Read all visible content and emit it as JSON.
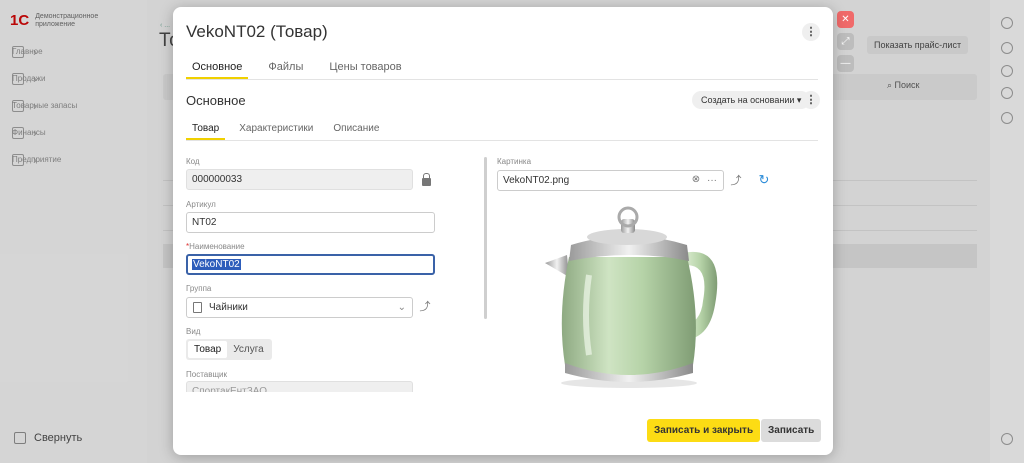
{
  "app": {
    "logo_mark": "1С",
    "logo_text": "Демонстрационное приложение",
    "nav": [
      {
        "label": "Главное"
      },
      {
        "label": "Продажи"
      },
      {
        "label": "Товарные запасы"
      },
      {
        "label": "Финансы"
      },
      {
        "label": "Предприятие"
      }
    ],
    "collapse_label": "Свернуть",
    "bg_title": "То",
    "bg_price_button": "Показать прайс-лист",
    "bg_search": "Поиск"
  },
  "modal": {
    "title": "VekoNT02 (Товар)",
    "tabs": [
      "Основное",
      "Файлы",
      "Цены товаров"
    ],
    "section_title": "Основное",
    "create_based_on": "Создать на основании",
    "subtabs": [
      "Товар",
      "Характеристики",
      "Описание"
    ],
    "fields": {
      "code_label": "Код",
      "code_value": "000000033",
      "sku_label": "Артикул",
      "sku_value": "NT02",
      "name_label": "Наименование",
      "name_value": "VekoNT02",
      "group_label": "Группа",
      "group_value": "Чайники",
      "kind_label": "Вид",
      "kind_options": [
        "Товар",
        "Услуга"
      ],
      "supplier_label": "Поставщик",
      "supplier_value": "СпортакЕнтЗАО",
      "image_label": "Картинка",
      "image_value": "VekoNT02.png"
    },
    "buttons": {
      "save_close": "Записать и закрыть",
      "save": "Записать"
    }
  },
  "colors": {
    "accent": "#fcdc14",
    "focus": "#3a62a8",
    "close": "#f06a6a"
  }
}
